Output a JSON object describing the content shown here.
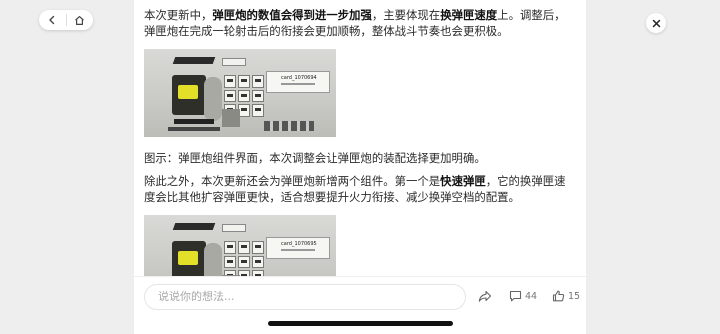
{
  "nav": {
    "back_icon": "chevron-left-icon",
    "home_icon": "home-icon"
  },
  "close_icon": "close-icon",
  "article": {
    "p1": {
      "t1": "本次更新中，",
      "b1": "弹匣炮的数值会得到进一步加强",
      "t2": "，主要体现在",
      "b2": "换弹匣速度",
      "t3": "上。调整后，弹匣炮在完成一轮射击后的衔接会更加顺畅，整体战斗节奏也会更积极。"
    },
    "image1": {
      "panel_title": "card_1070694"
    },
    "caption": "图示：弹匣炮组件界面，本次调整会让弹匣炮的装配选择更加明确。",
    "p2": {
      "t1": "除此之外，本次更新还会为弹匣炮新增两个组件。第一个是",
      "b1": "快速弹匣",
      "t2": "，它的换弹匣速度会比其他扩容弹匣更快，适合想要提升火力衔接、减少换弹空档的配置。"
    },
    "image2": {
      "panel_title": "card_1070695"
    }
  },
  "bottom": {
    "comment_placeholder": "说说你的想法...",
    "comments_count": "44",
    "likes_count": "15"
  }
}
